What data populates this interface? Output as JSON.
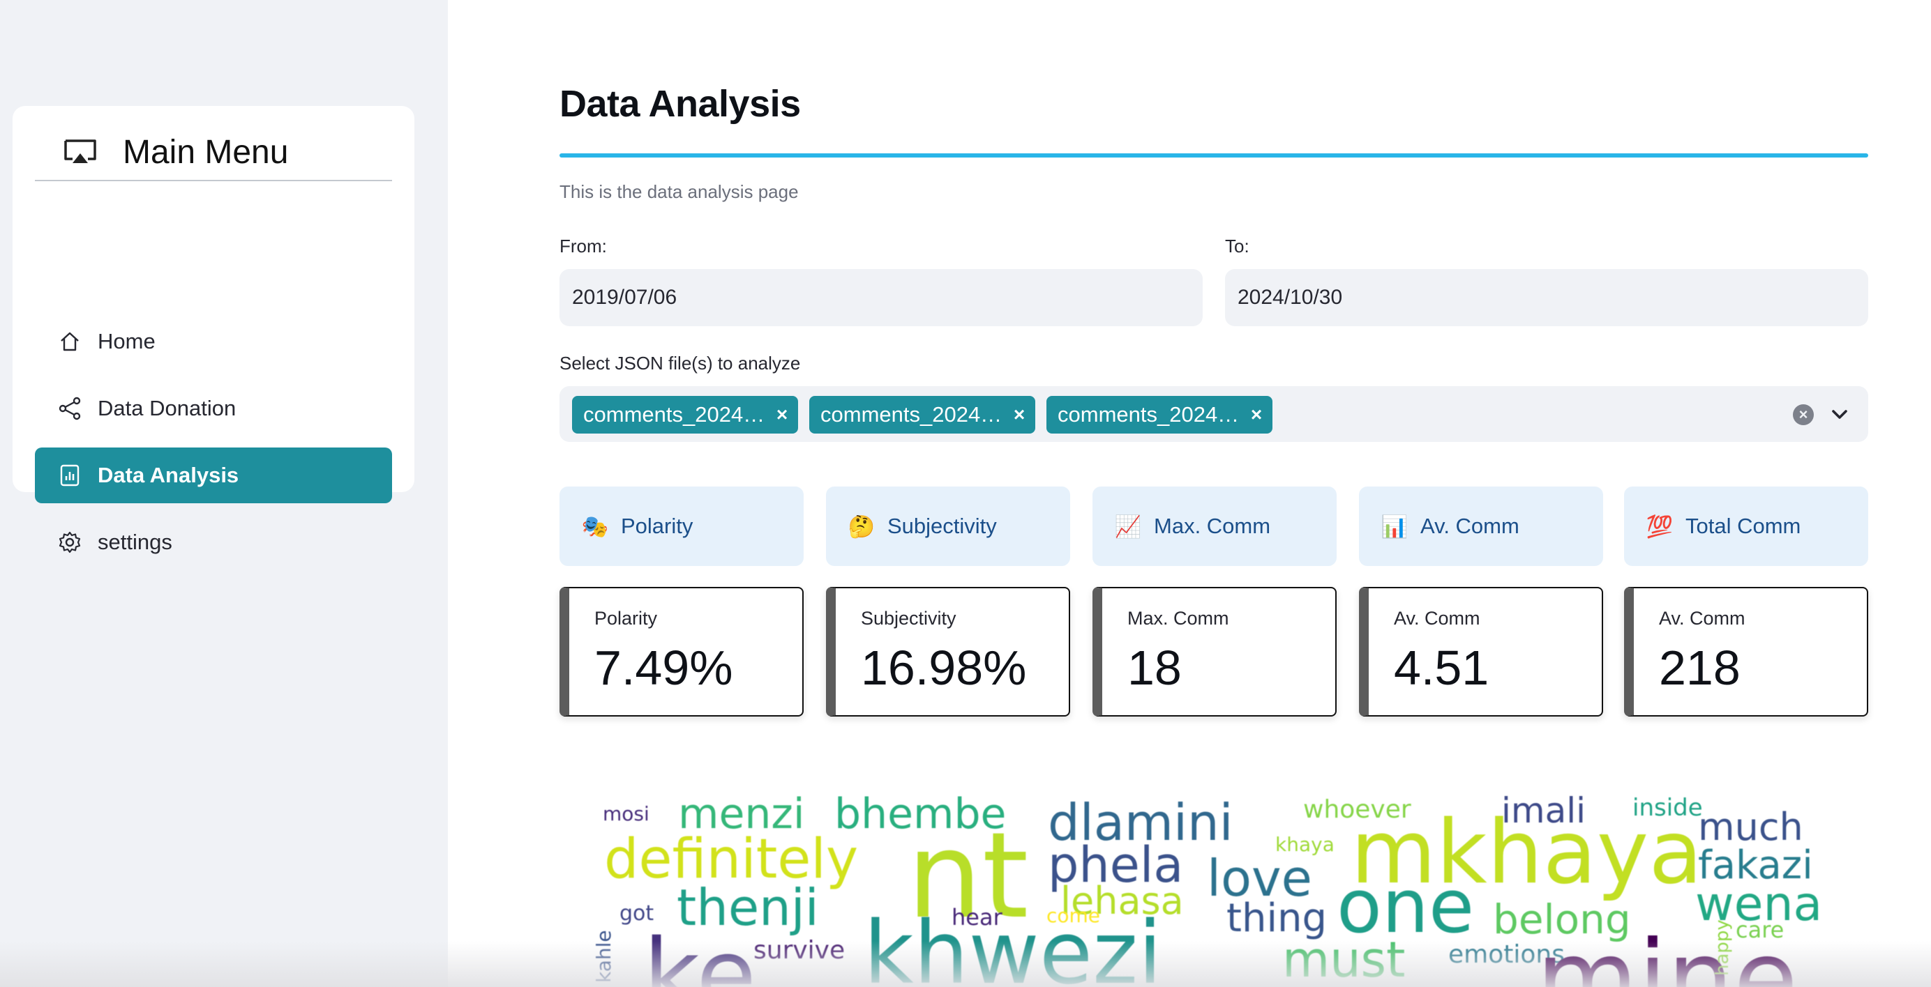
{
  "sidebar": {
    "menu_title": "Main Menu",
    "menu_icon": "cast-icon",
    "items": [
      {
        "label": "Home",
        "icon": "house-icon",
        "active": false
      },
      {
        "label": "Data Donation",
        "icon": "share-icon",
        "active": false
      },
      {
        "label": "Data Analysis",
        "icon": "bar-chart-icon",
        "active": true
      },
      {
        "label": "settings",
        "icon": "gear-icon",
        "active": false
      }
    ]
  },
  "main": {
    "title": "Data Analysis",
    "caption": "This is the data analysis page",
    "from": {
      "label": "From:",
      "value": "2019/07/06"
    },
    "to": {
      "label": "To:",
      "value": "2024/10/30"
    },
    "file_select": {
      "label": "Select JSON file(s) to analyze",
      "chips": [
        "comments_2024…",
        "comments_2024…",
        "comments_2024…"
      ],
      "remove_glyph": "×",
      "clear_glyph": "×"
    },
    "tabs": [
      {
        "label": "Polarity",
        "emoji": "🎭"
      },
      {
        "label": "Subjectivity",
        "emoji": "🤔"
      },
      {
        "label": "Max. Comm",
        "emoji": "📈"
      },
      {
        "label": "Av. Comm",
        "emoji": "📊"
      },
      {
        "label": "Total Comm",
        "emoji": "💯"
      }
    ],
    "metrics": [
      {
        "label": "Polarity",
        "value": "7.49%"
      },
      {
        "label": "Subjectivity",
        "value": "16.98%"
      },
      {
        "label": "Max. Comm",
        "value": "18"
      },
      {
        "label": "Av. Comm",
        "value": "4.51"
      },
      {
        "label": "Av. Comm",
        "value": "218"
      }
    ],
    "wordcloud_words": [
      "mosi",
      "menzi",
      "bhembe",
      "dlamini",
      "whoever",
      "imali",
      "inside",
      "nt",
      "mkhaya",
      "much",
      "definitely",
      "phela",
      "love",
      "khaya",
      "fakazi",
      "lehasa",
      "thenji",
      "one",
      "wena",
      "got",
      "hear",
      "come",
      "thing",
      "belong",
      "care",
      "survive",
      "khwezi",
      "must",
      "emotions",
      "mine",
      "ke",
      "kahle",
      "happy"
    ]
  },
  "colors": {
    "accent": "#1e8f9d",
    "title_rule": "#29b5e8",
    "sidebar_bg": "#f0f2f6",
    "tab_bg": "#e6f1fb",
    "tab_text": "#1b4f8a"
  }
}
